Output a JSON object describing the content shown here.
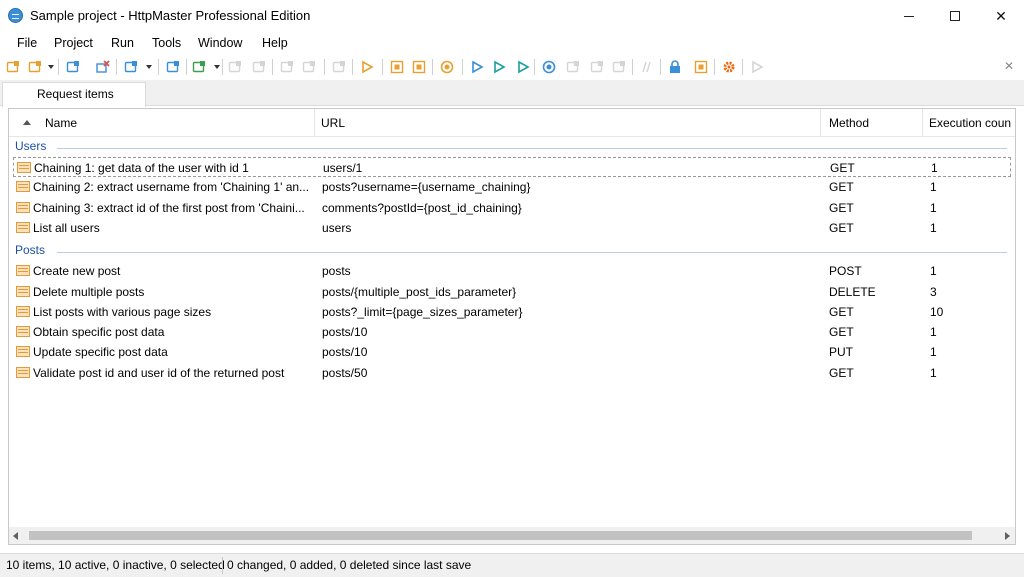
{
  "window": {
    "title": "Sample project - HttpMaster Professional Edition",
    "minimize_icon": "minimize-icon",
    "maximize_icon": "maximize-icon",
    "close_glyph": "✕"
  },
  "menu": [
    "File",
    "Project",
    "Run",
    "Tools",
    "Window",
    "Help"
  ],
  "toolbar": {
    "close_glyph": "✕",
    "buttons": [
      {
        "icon": "add-item-icon",
        "color": "#e8a030",
        "enabled": true
      },
      {
        "icon": "add-group-icon",
        "color": "#e8a030",
        "enabled": true
      },
      {
        "icon": "home-icon",
        "color": "#3b8fd8",
        "enabled": true
      },
      {
        "icon": "delete-icon",
        "color": "#d9534f",
        "enabled": true
      },
      {
        "icon": "edit-icon",
        "color": "#3b8fd8",
        "enabled": true
      },
      {
        "icon": "clone-icon",
        "color": "#3b8fd8",
        "enabled": true
      },
      {
        "icon": "add-parameter-icon",
        "color": "#3aa04a",
        "enabled": true
      },
      {
        "icon": "move-up-icon",
        "color": "#888888",
        "enabled": false
      },
      {
        "icon": "move-down-icon",
        "color": "#888888",
        "enabled": false
      },
      {
        "icon": "collapse-icon",
        "color": "#888888",
        "enabled": false
      },
      {
        "icon": "expand-icon",
        "color": "#888888",
        "enabled": false
      },
      {
        "icon": "group-icon",
        "color": "#888888",
        "enabled": false
      },
      {
        "icon": "run-order-icon",
        "color": "#e8a030",
        "enabled": true
      },
      {
        "icon": "select-icon",
        "color": "#e8a030",
        "enabled": true
      },
      {
        "icon": "find-icon",
        "color": "#e8a030",
        "enabled": true
      },
      {
        "icon": "globe-icon",
        "color": "#e8a030",
        "enabled": true
      },
      {
        "icon": "run-icon",
        "color": "#3b8fd8",
        "enabled": true
      },
      {
        "icon": "run-all-icon",
        "color": "#1aa0a0",
        "enabled": true
      },
      {
        "icon": "run-selected-icon",
        "color": "#1aa0a0",
        "enabled": true
      },
      {
        "icon": "execute-icon",
        "color": "#3b8fd8",
        "enabled": true
      },
      {
        "icon": "stop-icon",
        "color": "#888888",
        "enabled": false
      },
      {
        "icon": "results-icon",
        "color": "#888888",
        "enabled": false
      },
      {
        "icon": "step-icon",
        "color": "#888888",
        "enabled": false
      },
      {
        "icon": "comment-icon",
        "color": "#888888",
        "enabled": false
      },
      {
        "icon": "lock-icon",
        "color": "#3b8fd8",
        "enabled": true
      },
      {
        "icon": "cookie-icon",
        "color": "#e8a030",
        "enabled": true
      },
      {
        "icon": "settings-icon",
        "color": "#e86a10",
        "enabled": true
      },
      {
        "icon": "forward-icon",
        "color": "#888888",
        "enabled": false
      }
    ]
  },
  "tabs": [
    {
      "label": "Request items"
    }
  ],
  "table": {
    "columns": [
      "Name",
      "URL",
      "Method",
      "Execution coun"
    ],
    "groups": [
      {
        "name": "Users",
        "rows": [
          {
            "name": "Chaining 1: get data of the user with id 1",
            "url": "users/1",
            "method": "GET",
            "count": "1"
          },
          {
            "name": "Chaining 2: extract username from 'Chaining 1' an...",
            "url": "posts?username={username_chaining}",
            "method": "GET",
            "count": "1"
          },
          {
            "name": "Chaining 3: extract id of the first post from 'Chaini...",
            "url": "comments?postId={post_id_chaining}",
            "method": "GET",
            "count": "1"
          },
          {
            "name": "List all users",
            "url": "users",
            "method": "GET",
            "count": "1"
          }
        ]
      },
      {
        "name": "Posts",
        "rows": [
          {
            "name": "Create new post",
            "url": "posts",
            "method": "POST",
            "count": "1"
          },
          {
            "name": "Delete multiple posts",
            "url": "posts/{multiple_post_ids_parameter}",
            "method": "DELETE",
            "count": "3"
          },
          {
            "name": "List posts with various page sizes",
            "url": "posts?_limit={page_sizes_parameter}",
            "method": "GET",
            "count": "10"
          },
          {
            "name": "Obtain specific post data",
            "url": "posts/10",
            "method": "GET",
            "count": "1"
          },
          {
            "name": "Update specific post data",
            "url": "posts/10",
            "method": "PUT",
            "count": "1"
          },
          {
            "name": "Validate post id and user id of the returned post",
            "url": "posts/50",
            "method": "GET",
            "count": "1"
          }
        ]
      }
    ]
  },
  "status": {
    "items": "10 items, 10 active, 0 inactive, 0 selected",
    "changes": "0 changed, 0 added, 0 deleted since last save"
  }
}
